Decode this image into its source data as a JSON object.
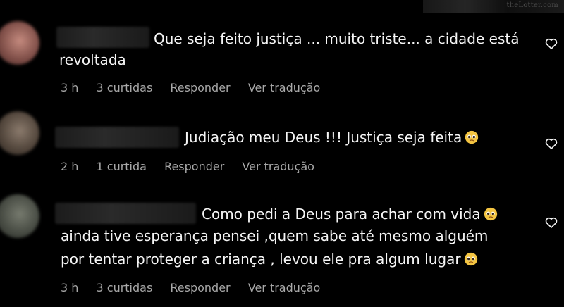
{
  "watermark": "theLotter.com",
  "comments": [
    {
      "line1": "Que seja feito justiça ... muito triste... a cidade está",
      "line2": "revoltada",
      "time": "3 h",
      "likes": "3 curtidas",
      "reply": "Responder",
      "translate": "Ver tradução",
      "avatar_color": "#a46a62"
    },
    {
      "line1": "Judiação meu Deus !!! Justiça seja feita",
      "time": "2 h",
      "likes": "1 curtida",
      "reply": "Responder",
      "translate": "Ver tradução",
      "avatar_color": "#6a5a4e",
      "emoji": "pleading-face-icon"
    },
    {
      "line1": "Como pedi a Deus para achar com vida",
      "line2": "ainda tive esperança pensei ,quem sabe até mesmo alguém",
      "line3": "por tentar proteger a criança , levou ele pra algum lugar",
      "time": "3 h",
      "likes": "3 curtidas",
      "reply": "Responder",
      "translate": "Ver tradução",
      "avatar_color": "#5a5f55",
      "emoji": "pleading-face-icon"
    }
  ],
  "colors": {
    "background": "#000000",
    "text": "#f5f5f5",
    "meta": "#a8a8a8"
  }
}
